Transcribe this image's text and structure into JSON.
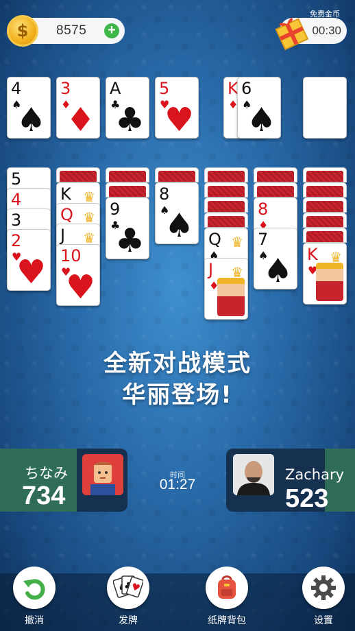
{
  "top_bar": {
    "coin_symbol": "$",
    "coin_count": "8575",
    "add_symbol": "+",
    "free_coins_label": "免费金币",
    "free_coins_timer": "00:30"
  },
  "foundation": [
    {
      "rank": "4",
      "suit": "♠",
      "color": "black"
    },
    {
      "rank": "3",
      "suit": "♦",
      "color": "red"
    },
    {
      "rank": "A",
      "suit": "♣",
      "color": "black"
    },
    {
      "rank": "5",
      "suit": "♥",
      "color": "red"
    }
  ],
  "waste": [
    {
      "rank": "K",
      "suit": "♦",
      "color": "red"
    },
    {
      "rank": "6",
      "suit": "♠",
      "color": "black"
    }
  ],
  "tableau": {
    "col1": [
      {
        "rank": "5",
        "suit": "♠",
        "color": "black"
      },
      {
        "rank": "4",
        "suit": "♥",
        "color": "red"
      },
      {
        "rank": "3",
        "suit": "♠",
        "color": "black"
      },
      {
        "rank": "2",
        "suit": "♥",
        "color": "red"
      }
    ],
    "col2": [
      {
        "rank": "K",
        "suit": "♠",
        "color": "black"
      },
      {
        "rank": "Q",
        "suit": "♥",
        "color": "red"
      },
      {
        "rank": "J",
        "suit": "♣",
        "color": "black"
      },
      {
        "rank": "10",
        "suit": "♥",
        "color": "red"
      }
    ],
    "col3": [
      {
        "rank": "9",
        "suit": "♣",
        "color": "black"
      }
    ],
    "col4": [
      {
        "rank": "8",
        "suit": "♠",
        "color": "black"
      }
    ],
    "col5": [
      {
        "rank": "Q",
        "suit": "♠",
        "color": "black"
      },
      {
        "rank": "J",
        "suit": "♦",
        "color": "red"
      }
    ],
    "col6": [
      {
        "rank": "8",
        "suit": "♦",
        "color": "red"
      },
      {
        "rank": "7",
        "suit": "♠",
        "color": "black"
      }
    ],
    "col7": [
      {
        "rank": "K",
        "suit": "♥",
        "color": "red"
      }
    ]
  },
  "headline": {
    "line1": "全新对战模式",
    "line2": "华丽登场!"
  },
  "match": {
    "player1_name": "ちなみ",
    "player1_score": "734",
    "time_label": "时间",
    "time_value": "01:27",
    "player2_name": "Zachary",
    "player2_score": "523"
  },
  "toolbar": {
    "undo": "撤消",
    "deal": "发牌",
    "card_backs": "纸牌背包",
    "settings": "设置"
  },
  "colors": {
    "card_red": "#d9141c",
    "card_back": "#c8242d",
    "coin_gold": "#f2b01c",
    "add_green": "#3fb84a"
  }
}
